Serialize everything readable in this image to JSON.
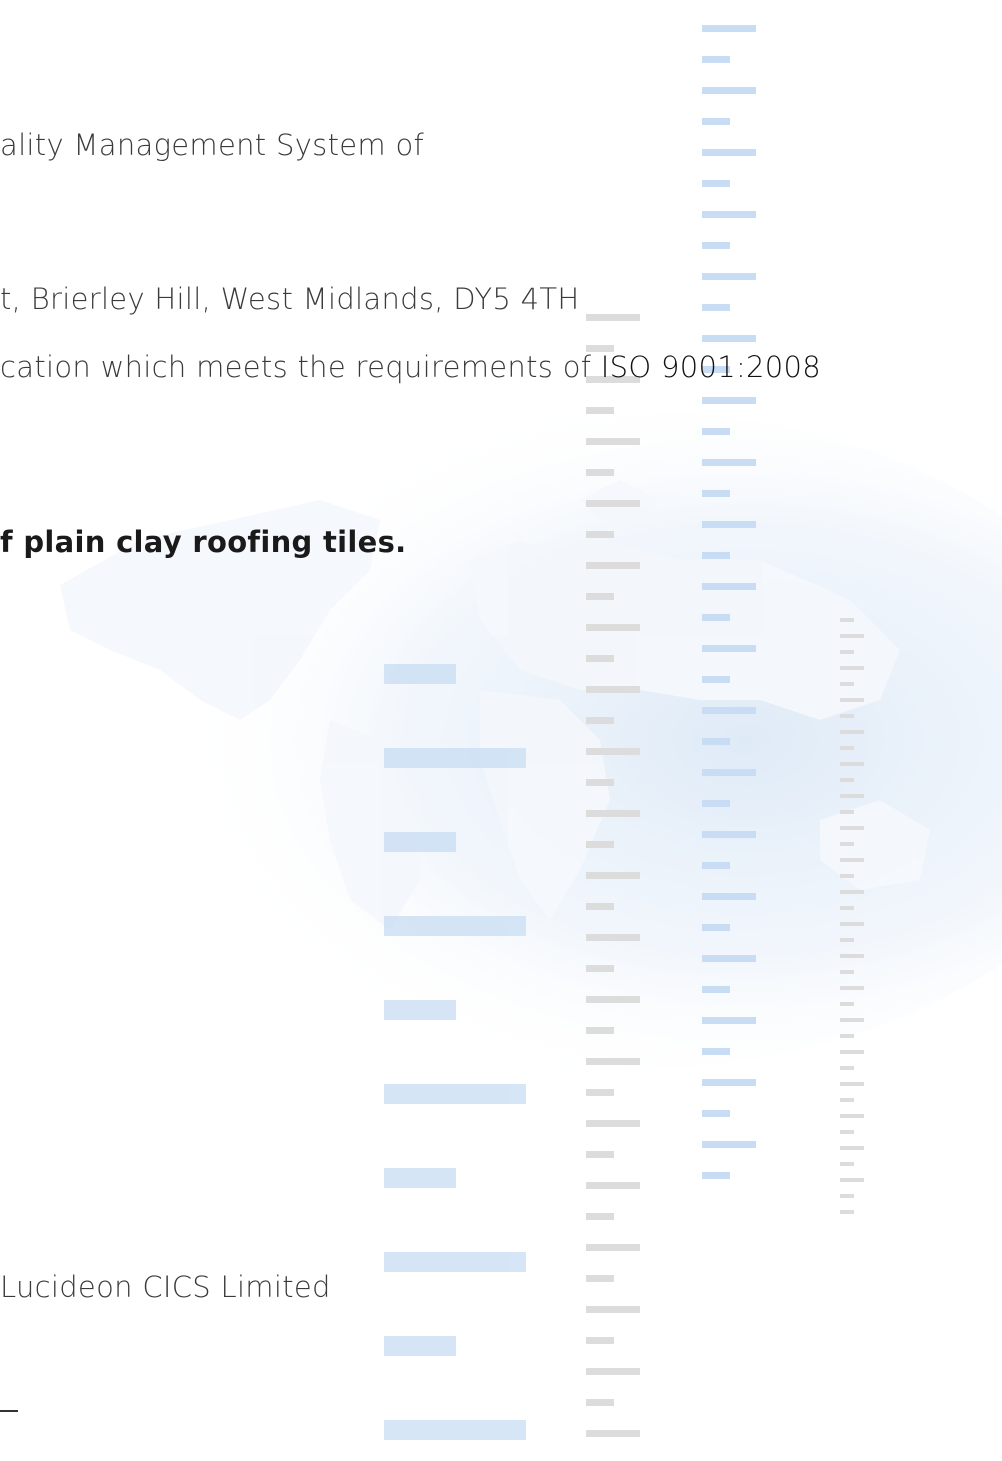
{
  "certificate": {
    "line_qms": "ality Management System of",
    "line_address": "t, Brierley Hill, West Midlands, DY5 4TH",
    "line_requirements_prefix": "cation which meets the requirements of ",
    "line_requirements_standard": "ISO 9001:2008",
    "line_scope": "f plain clay roofing tiles.",
    "line_issuer": "Lucideon CICS Limited"
  },
  "colors": {
    "blue_bar": "#c8ddf3",
    "grey_bar": "#dcdcdc",
    "map_tint": "#e3eefa"
  },
  "decor": {
    "map": "world-map-watermark",
    "bars": "dash-bar-pattern"
  }
}
